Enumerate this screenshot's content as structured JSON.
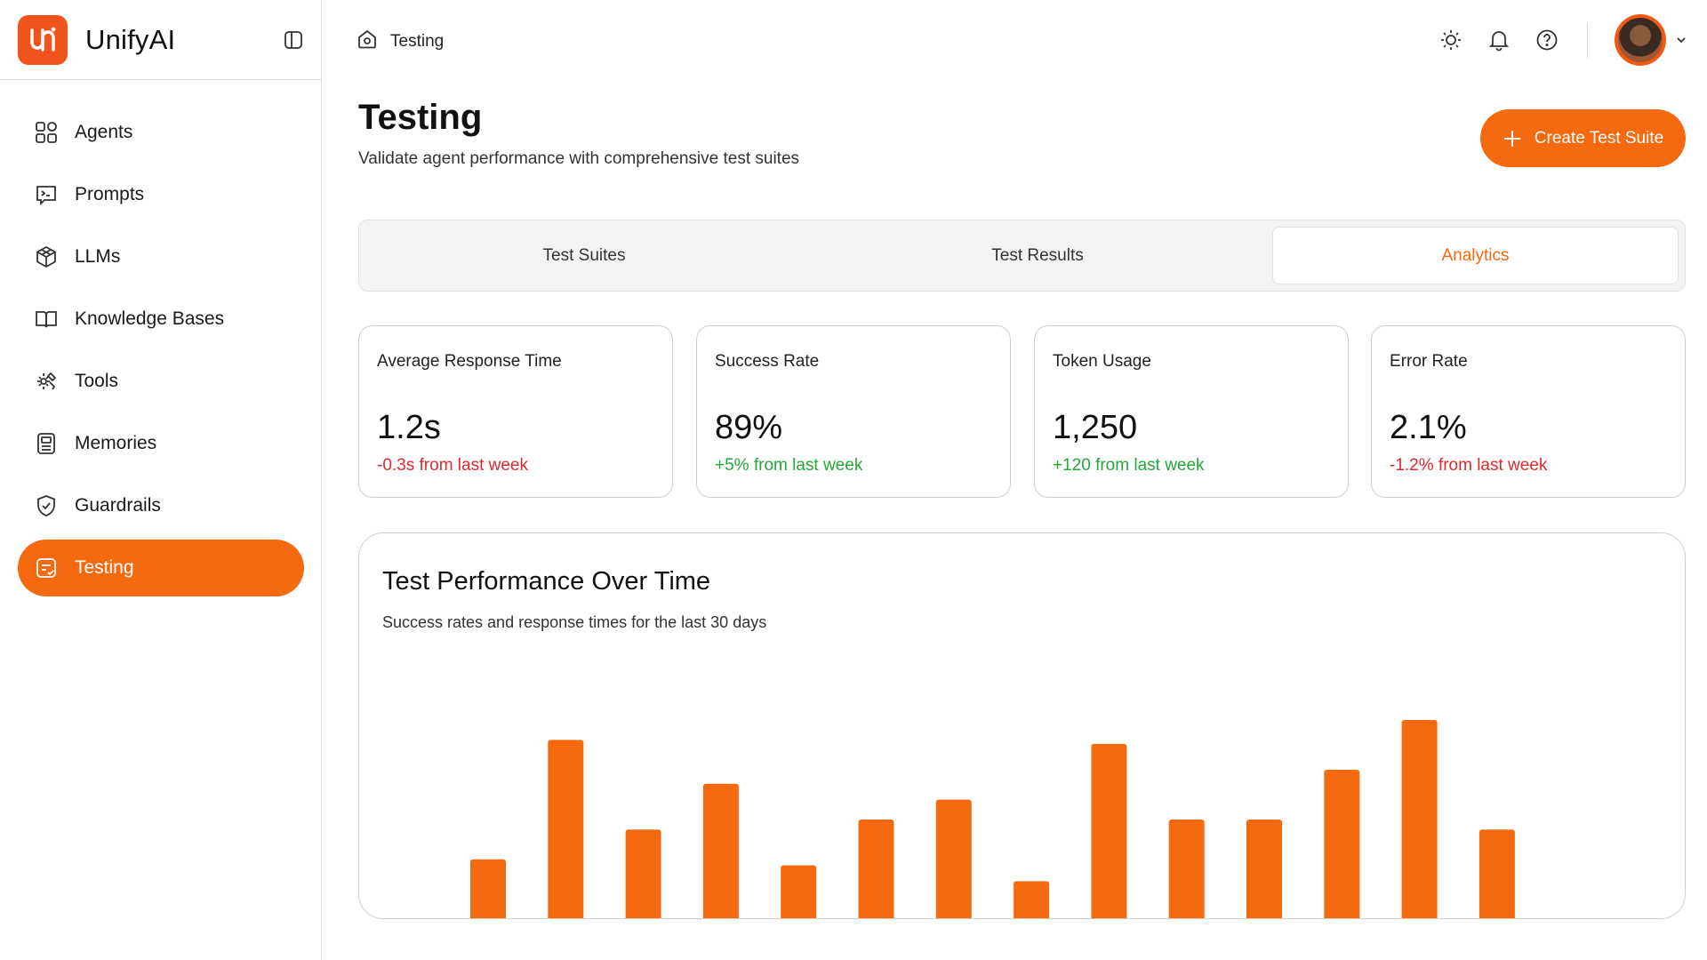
{
  "app": {
    "name": "UnifyAI"
  },
  "sidebar": {
    "items": [
      {
        "label": "Agents",
        "icon": "grid-icon",
        "active": false
      },
      {
        "label": "Prompts",
        "icon": "terminal-icon",
        "active": false
      },
      {
        "label": "LLMs",
        "icon": "cube-icon",
        "active": false
      },
      {
        "label": "Knowledge Bases",
        "icon": "book-icon",
        "active": false
      },
      {
        "label": "Tools",
        "icon": "gear-icon",
        "active": false
      },
      {
        "label": "Memories",
        "icon": "memory-icon",
        "active": false
      },
      {
        "label": "Guardrails",
        "icon": "shield-icon",
        "active": false
      },
      {
        "label": "Testing",
        "icon": "test-icon",
        "active": true
      }
    ]
  },
  "header": {
    "breadcrumb": "Testing"
  },
  "main": {
    "title": "Testing",
    "subtitle": "Validate agent performance with comprehensive test suites",
    "create_button": "Create Test Suite"
  },
  "tabs": [
    {
      "label": "Test Suites",
      "active": false
    },
    {
      "label": "Test Results",
      "active": false
    },
    {
      "label": "Analytics",
      "active": true
    }
  ],
  "metrics": [
    {
      "title": "Average Response Time",
      "value": "1.2s",
      "delta": "-0.3s from last week",
      "trend": "negative"
    },
    {
      "title": "Success Rate",
      "value": "89%",
      "delta": "+5% from last week",
      "trend": "positive"
    },
    {
      "title": "Token Usage",
      "value": "1,250",
      "delta": "+120 from last week",
      "trend": "positive"
    },
    {
      "title": "Error Rate",
      "value": "2.1%",
      "delta": "-1.2% from last week",
      "trend": "negative"
    }
  ],
  "colors": {
    "accent": "#f56a10",
    "negative": "#e0282e",
    "positive": "#22a83a"
  },
  "chart_data": {
    "type": "bar",
    "title": "Test Performance Over Time",
    "subtitle": "Success rates and response times for the last 30 days",
    "values": [
      30,
      90,
      45,
      68,
      27,
      50,
      60,
      19,
      88,
      50,
      50,
      75,
      100,
      45
    ],
    "ylim": [
      0,
      100
    ],
    "grid": false,
    "color": "#f56a10"
  }
}
